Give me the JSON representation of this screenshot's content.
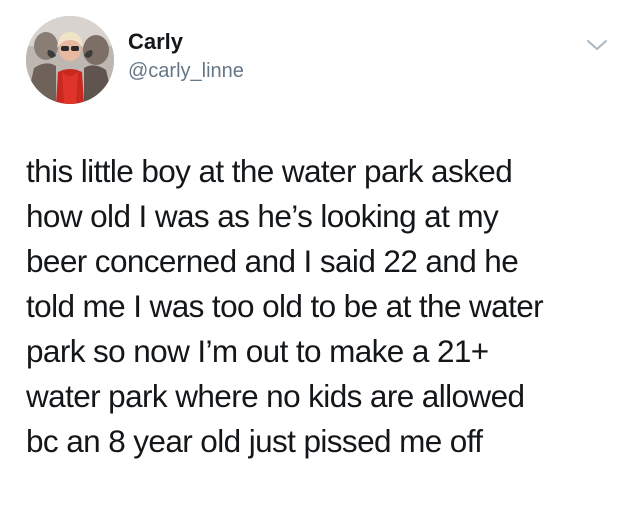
{
  "tweet": {
    "author": {
      "display_name": "Carly",
      "handle": "@carly_linne",
      "avatar_icon": "profile-photo"
    },
    "menu_icon": "chevron-down-icon",
    "text_lines": [
      "this little boy at the water park asked",
      "how old I was as he’s looking at my",
      "beer concerned and I said 22 and he",
      "told me I was too old to be at the water",
      "park so now I’m out to make a 21+",
      "water park where no kids are allowed",
      "bc an 8 year old just pissed me off"
    ]
  },
  "colors": {
    "text": "#14171a",
    "secondary_text": "#657786",
    "chevron": "#aab8c2",
    "background": "#ffffff"
  }
}
